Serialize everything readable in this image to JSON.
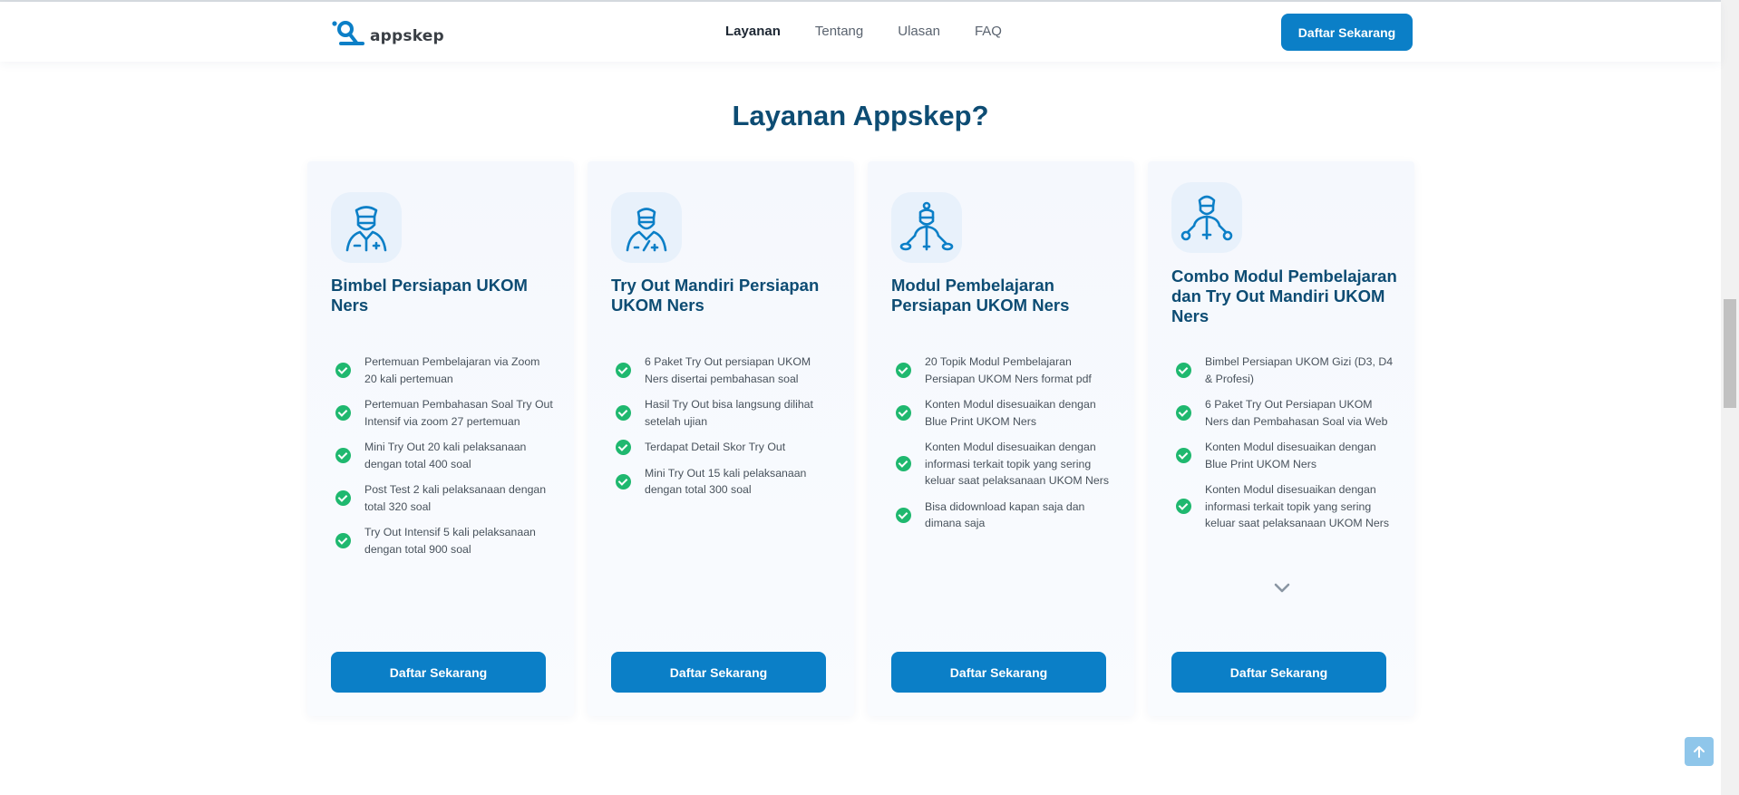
{
  "header": {
    "logo_text": "appskep",
    "nav": [
      {
        "label": "Layanan",
        "active": true
      },
      {
        "label": "Tentang",
        "active": false
      },
      {
        "label": "Ulasan",
        "active": false
      },
      {
        "label": "FAQ",
        "active": false
      }
    ],
    "cta_label": "Daftar Sekarang"
  },
  "section": {
    "title": "Layanan Appskep?"
  },
  "cards": [
    {
      "icon": "nurse-icon",
      "title": "Bimbel Persiapan UKOM Ners",
      "features": [
        "Pertemuan Pembelajaran via Zoom 20 kali pertemuan",
        "Pertemuan Pembahasan Soal Try Out Intensif via zoom 27 pertemuan",
        "Mini Try Out 20 kali pelaksanaan dengan total 400 soal",
        "Post Test 2 kali pelaksanaan dengan total 320 soal",
        "Try Out Intensif 5 kali pelaksanaan dengan total 900 soal"
      ],
      "button_label": "Daftar Sekarang"
    },
    {
      "icon": "nurse-icon",
      "title": "Try Out Mandiri Persiapan UKOM Ners",
      "features": [
        "6 Paket Try Out persiapan UKOM Ners disertai pembahasan soal",
        "Hasil Try Out bisa langsung dilihat setelah ujian",
        "Terdapat Detail Skor Try Out",
        "Mini Try Out 15 kali pelaksanaan dengan total 300 soal"
      ],
      "button_label": "Daftar Sekarang"
    },
    {
      "icon": "nurse-network-icon",
      "title": "Modul Pembelajaran Persiapan UKOM Ners",
      "features": [
        "20 Topik Modul Pembelajaran Persiapan UKOM Ners format pdf",
        "Konten Modul disesuaikan dengan Blue Print UKOM Ners",
        "Konten Modul disesuaikan dengan informasi terkait topik yang sering keluar saat pelaksanaan UKOM Ners",
        "Bisa didownload kapan saja dan dimana saja"
      ],
      "button_label": "Daftar Sekarang"
    },
    {
      "icon": "nurse-network-icon",
      "title": "Combo Modul Pembelajaran dan Try Out Mandiri UKOM Ners",
      "features": [
        "Bimbel Persiapan UKOM Gizi (D3, D4 & Profesi)",
        "6 Paket Try Out Persiapan UKOM Ners dan Pembahasan Soal via Web",
        "Konten Modul disesuaikan dengan Blue Print UKOM Ners",
        "Konten Modul disesuaikan dengan informasi terkait topik yang sering keluar saat pelaksanaan UKOM Ners"
      ],
      "show_more_icon": "chevron-down-icon",
      "button_label": "Daftar Sekarang"
    }
  ],
  "scroll_to_top_icon": "arrow-up-icon",
  "colors": {
    "primary": "#0b7fc7",
    "heading": "#0d4c73",
    "check": "#1fb86f"
  }
}
